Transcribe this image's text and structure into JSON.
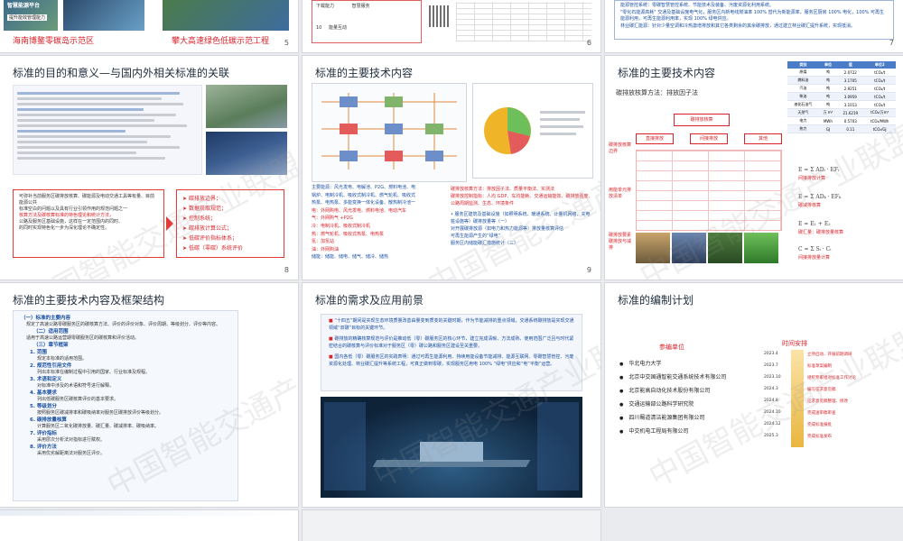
{
  "top_row": {
    "s5": {
      "label1": "智慧能源平台",
      "label2": "提升能效管理能力",
      "caption_left": "海南博鳌零碳岛示范区",
      "caption_right": "攀大高速绿色低碳示范工程",
      "page": "5"
    },
    "s6": {
      "row1": "下载能力",
      "row1_b": "智慧服务",
      "row2_num": "10",
      "row2": "能量互动",
      "page": "6"
    },
    "s7": {
      "line1": "能源管控系统：零碳智慧管控系统、节能技术及装备、污废资源化利用系统。",
      "line2": "\"零化石能源高耗\" 交通及基础设施电气化，服务区内新电线燃油率 100% 替代为新能源率，服务区厨房 100% 电化，100% 可再生能源利用，可再生能源利用率，实现 100% 绿电供应。",
      "line3": "林业碳汇能源：针对少量空调和冷热激增排放和其它各类剩余的其余碳排放，通过建立林业碳汇提升系统，实现抵消。",
      "page": "7"
    }
  },
  "s8": {
    "title": "标准的目的和意义—与国内外相关标准的关联",
    "note_lines": [
      "可弥补当前服务区碳排放核算、碳能源及电动交通工具等有量、目前能源公共",
      "标准空白的问题以及具有行业引领作用的规范问题之一",
      "核算方法及碳核算标准的特色理论和统计方法，",
      "公路及服务区基础设施，这样在一定范围内的同时、",
      "的同时实现特色化一步为深化理论不确定性。"
    ],
    "list": [
      "碳排放边界；",
      "数据获取规范；",
      "控制系统；",
      "碳排放计算公式；",
      "低碳评价指标体系；",
      "低碳（零碳）系统评价"
    ],
    "page": "8"
  },
  "s9": {
    "title": "标准的主要技术内容",
    "energy_lines": [
      "主要能源：风光发电、电解池、P2G、燃料电池、电",
      "锅炉、电制冷机、吸收式制冷机、燃气轮机、吸收式",
      "热泵、电热泵、多能变换一体化设备、散热制冷池一",
      "电：外网购电、风光发电、燃料电池、电动汽车",
      "气：外网购气 +P2G",
      "冷：电制冷机、吸收式制冷机",
      "热：燃气轮机、吸收式热泵、电热泵",
      "氢：加氢站",
      "油：外网购油",
      "储能：储能、储电、储气、储冷、储热"
    ],
    "right_lines": [
      "碳排放核算方法：排放因子法、质量平衡法、实测法",
      "碳排放控制指标：人均 GDP、车均能耗、交通运输能效、碳排放强度、公路周期监测、生态、环境条件",
      "服务区建筑及基础设施（如照明系统、暖通系统、计量机网络、充电桩设施等）碳排放量等（一）",
      "对开展碳排放源（如电力和热力能源等）排放量核算评估",
      "可再生能源产生的“绿电”",
      "服务区内储能碳汇措施统计（三）"
    ],
    "page": "9"
  },
  "s10": {
    "title": "标准的主要技术内容",
    "subtitle": "碳排放核算方法：排放因子法",
    "top_box": "碳排放核算",
    "left_labels": [
      "碳排放核算边界",
      "用能单元排放清单",
      "碳排放要素碳排放与减排"
    ],
    "mid_boxes": [
      "直接排放",
      "间接排放",
      "其他"
    ],
    "table_headers": [
      "类别",
      "单位",
      "值",
      "单位2"
    ],
    "table_rows": [
      [
        "原煤",
        "吨",
        "2.0722",
        "tCO₂/t"
      ],
      [
        "燃料油",
        "吨",
        "3.1705",
        "tCO₂/t"
      ],
      [
        "汽油",
        "吨",
        "2.9251",
        "tCO₂/t"
      ],
      [
        "柴油",
        "吨",
        "3.0959",
        "tCO₂/t"
      ],
      [
        "液化石油气",
        "吨",
        "3.1013",
        "tCO₂/t"
      ],
      [
        "天然气",
        "万 m³",
        "21.6219",
        "tCO₂/万m³"
      ],
      [
        "电力",
        "MWh",
        "0.5703",
        "tCO₂/MWh"
      ],
      [
        "热力",
        "GJ",
        "0.11",
        "tCO₂/GJ"
      ]
    ],
    "formula_notes": [
      "间接排放计算",
      "碳减排核算",
      "碳汇量：碳排放量核算",
      "间接排放量计算"
    ],
    "page": ""
  },
  "s11": {
    "title": "标准的主要技术内容及框架结构",
    "sections": [
      {
        "h": "（一）标准的主要内容",
        "t": "规定了高速公路零碳服务区的碳核算方法、评价的评价对象、评价周期、等级划分、评价等内容。"
      },
      {
        "h": "（二）适用范围",
        "t": "适用于高速公路运营期零碳服务区的碳核算和评价活动。"
      },
      {
        "h": "（三）章节框架",
        "t": ""
      }
    ],
    "chapters": [
      {
        "h": "1. 范围",
        "t": "规定本标准的适用范围。"
      },
      {
        "h": "2. 规范性引用文件",
        "t": "列出本标准在编制过程中引用的国家、行业标准及规程。"
      },
      {
        "h": "3. 术语和定义",
        "t": "对标准中涉及的术语和符号进行解释。"
      },
      {
        "h": "4. 基本要求",
        "t": "列出低碳服务区碳核算评价的基本要求。"
      },
      {
        "h": "5. 等级划分",
        "t": "按照服务区碳减排率和碳吸纳率对服务区碳排放评价等级划分。"
      },
      {
        "h": "6. 碳排放量核算",
        "t": "计算服务区二氧化碳排放量、碳汇量、碳减排率、碳吸纳率。"
      },
      {
        "h": "7. 评价指标",
        "t": "采用层次分析法对指标进行赋权。"
      },
      {
        "h": "8. 评价方法",
        "t": "采用优劣解距离法对服务区评价。"
      }
    ]
  },
  "s12": {
    "title": "标准的需求及应用前景",
    "paragraphs": [
      "“十四五”期间是实现生态环境质量改善由量变到质变的关键时期，作为节能减排的重点领域，交通系统碳排放是实现交通领域“双碳”目标的关键环节。",
      "碳排放的精确核算规范与评价是推动低（零）碳服务区的核心环节，建立完成清晰、方法成熟、使用范围广泛且与时代紧密结合的碳核算与评价标准对于服务区（零）碳公路和服务区建设至关重要。",
      "国内各低（零）碳服务区的实践表明：通过可再生能源利用、持续用能设备节能减排、能源互联网、零碳智慧管控、污废资源化处理、林业碳汇提升等系统工程，可真正做到零碳，实现服务区用电 100% “绿电”供应和“电”平衡“运营。"
    ]
  },
  "s13": {
    "title": "标准的编制计划",
    "col1_title": "参编单位",
    "col2_title": "时间安排",
    "orgs": [
      "华北电力大学",
      "北京中交国通智能交通系统技术有限公司",
      "北京能高自动化技术股份有限公司",
      "交通运输部公路科学研究院",
      "四川蜀道清洁能源集团有限公司",
      "中交机电工程局有限公司"
    ],
    "dates": [
      "2023.4",
      "2023.7",
      "2023.10",
      "2024.3",
      "2024.8",
      "2024.10",
      "2024.12",
      "2025.3"
    ],
    "steps": [
      "立项启动、开展前期调研",
      "标准草案编制",
      "组织专家组对标准工作讨论",
      "编写征求意见稿",
      "征求意见稿整理、修改",
      "完成送审稿审查",
      "完成标准报批",
      "完成标准发布"
    ]
  },
  "watermark": "中国智能交通产业联盟",
  "colors": {
    "accent_red": "#d8232a",
    "accent_blue": "#1a4fa3",
    "nav_red": "#e53935",
    "table_blue": "#4a7cc7"
  }
}
